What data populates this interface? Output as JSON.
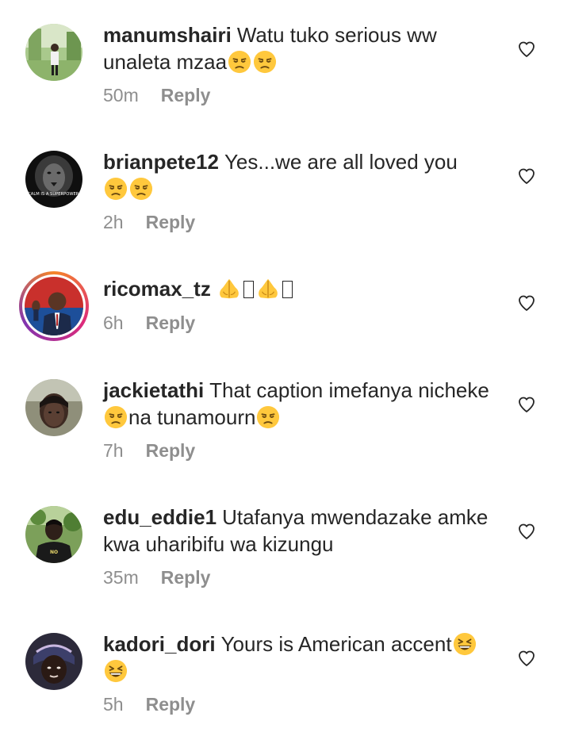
{
  "comments": [
    {
      "username": "manumshairi",
      "text_before": "Watu tuko serious ww unaleta mzaa",
      "text_after": "",
      "time": "50m",
      "reply_label": "Reply",
      "emoji": "unamused-face-icon"
    },
    {
      "username": "brianpete12",
      "text_before": "Yes...we are all loved you",
      "text_after": "",
      "time": "2h",
      "reply_label": "Reply",
      "emoji": "unamused-face-icon"
    },
    {
      "username": "ricomax_tz",
      "text_before": "",
      "text_after": "",
      "time": "6h",
      "reply_label": "Reply",
      "emoji": "folded-hands-icon"
    },
    {
      "username": "jackietathi",
      "text_before": "That caption imefanya nicheke",
      "text_middle": "na tunamourn",
      "time": "7h",
      "reply_label": "Reply",
      "emoji": "unamused-face-icon"
    },
    {
      "username": "edu_eddie1",
      "text_before": "Utafanya mwendazake amke kwa uharibifu wa kizungu",
      "time": "35m",
      "reply_label": "Reply"
    },
    {
      "username": "kadori_dori",
      "text_before": "Yours is American accent",
      "time": "5h",
      "reply_label": "Reply",
      "emoji": "grinning-squinting-face-icon"
    }
  ],
  "colors": {
    "text": "#262626",
    "meta": "#8e8e8e",
    "emoji_yellow": "#ffc83d",
    "story_ring": [
      "#f58529",
      "#dd2a7b",
      "#8134af"
    ]
  }
}
